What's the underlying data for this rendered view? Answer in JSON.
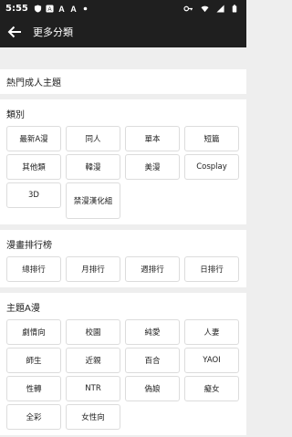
{
  "status": {
    "time": "5:55",
    "icons_left": [
      "shield-icon",
      "notification-a-icon",
      "notification-a-icon",
      "notification-a-icon",
      "dot-icon"
    ],
    "icons_right": [
      "key-icon",
      "wifi-icon",
      "signal-icon",
      "battery-icon"
    ]
  },
  "appbar": {
    "title": "更多分類"
  },
  "hot": {
    "title": "熱門成人主題"
  },
  "category": {
    "title": "類別",
    "items": [
      "最新A漫",
      "同人",
      "單本",
      "短篇",
      "其他類",
      "韓漫",
      "美漫",
      "Cosplay",
      "3D",
      "禁漫漢化組"
    ]
  },
  "ranking": {
    "title": "漫畫排行榜",
    "items": [
      "總排行",
      "月排行",
      "週排行",
      "日排行"
    ]
  },
  "theme": {
    "title": "主題A漫",
    "items": [
      "劇情向",
      "校園",
      "純愛",
      "人妻",
      "師生",
      "近親",
      "百合",
      "YAOI",
      "性轉",
      "NTR",
      "偽娘",
      "癡女",
      "全彩",
      "女性向"
    ]
  },
  "colors": {
    "bar": "#1f1f1f",
    "background": "#eeeeee",
    "chip_border": "#dcdcdc"
  }
}
